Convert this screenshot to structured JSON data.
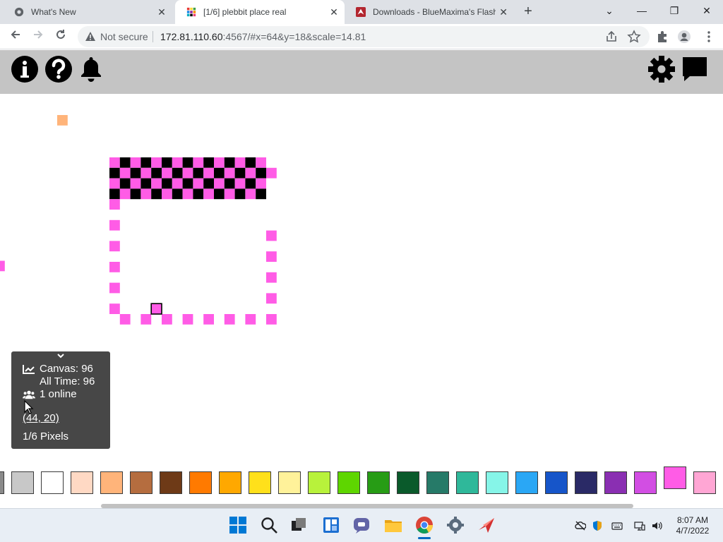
{
  "browser": {
    "tabs": [
      {
        "title": "What's New",
        "icon": "chrome-logo-icon"
      },
      {
        "title": "[1/6] plebbit place real",
        "icon": "color-grid-favicon-icon"
      },
      {
        "title": "Downloads - BlueMaxima's Flash",
        "icon": "flashpoint-favicon-icon"
      }
    ],
    "new_tab": "+",
    "close": "✕",
    "window_controls": [
      "⌄",
      "—",
      "❐",
      "✕"
    ],
    "security_label": "Not secure",
    "url_host": "172.81.110.60",
    "url_rest": ":4567/#x=64&y=18&scale=14.81"
  },
  "app": {
    "header_icons": [
      "info-icon",
      "help-icon",
      "bell-icon",
      "settings-gear-icon",
      "chat-icon"
    ]
  },
  "stats": {
    "canvas_label": "Canvas: 96",
    "alltime_label": "All Time: 96",
    "online_label": "1 online",
    "coords": "(44, 20)",
    "pixels_label": "1/6 Pixels"
  },
  "palette": {
    "colors": [
      "#8a8a8a",
      "#c8c8c8",
      "#ffffff",
      "#ffd9c4",
      "#ffb47a",
      "#b56d3f",
      "#6e3a17",
      "#ff7a00",
      "#ffa800",
      "#ffe01b",
      "#fff29a",
      "#b8f23b",
      "#5ed600",
      "#279c15",
      "#0a5a2b",
      "#267a68",
      "#2fb89a",
      "#86f5e8",
      "#2aa7f5",
      "#1655c9",
      "#2a2a66",
      "#8a2fb2",
      "#d24ee3",
      "#ff5ce6",
      "#ffa6d4"
    ],
    "selected_index": 23
  },
  "pixel_colors": {
    "black": "#000000",
    "pink": "#ff5ce6",
    "peach": "#ffb47a"
  },
  "taskbar": {
    "time": "8:07 AM",
    "date": "4/7/2022"
  }
}
